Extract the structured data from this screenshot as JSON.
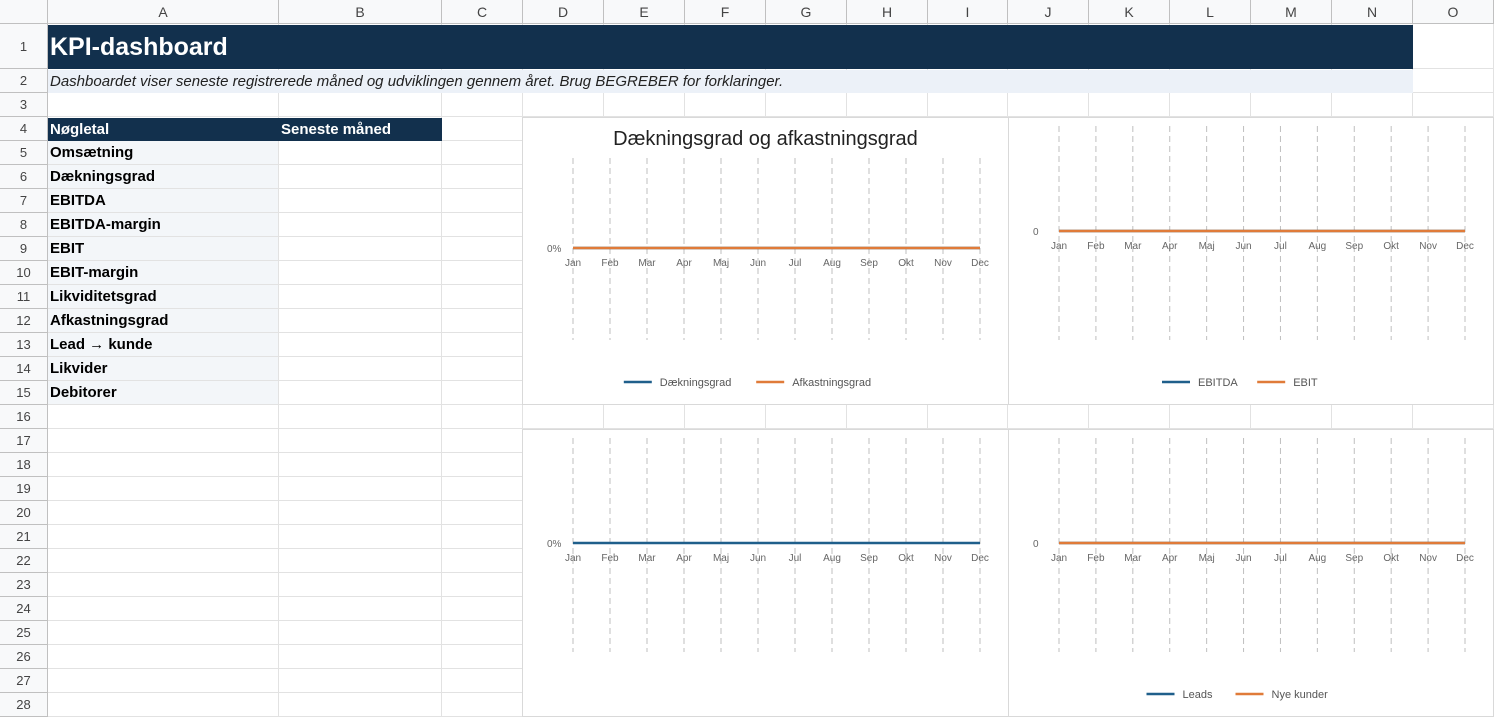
{
  "columns": [
    "A",
    "B",
    "C",
    "D",
    "E",
    "F",
    "G",
    "H",
    "I",
    "J",
    "K",
    "L",
    "M",
    "N",
    "O"
  ],
  "rows": [
    "1",
    "2",
    "3",
    "4",
    "5",
    "6",
    "7",
    "8",
    "9",
    "10",
    "11",
    "12",
    "13",
    "14",
    "15",
    "16",
    "17",
    "18",
    "19",
    "20",
    "21",
    "22",
    "23",
    "24",
    "25",
    "26",
    "27",
    "28"
  ],
  "sheet": {
    "title": "KPI-dashboard",
    "subtitle": "Dashboardet viser seneste registrerede måned og udviklingen gennem året. Brug BEGREBER for forklaringer.",
    "table_header": {
      "col1": "Nøgletal",
      "col2": "Seneste måned"
    },
    "kpis": [
      "Omsætning",
      "Dækningsgrad",
      "EBITDA",
      "EBITDA-margin",
      "EBIT",
      "EBIT-margin",
      "Likviditetsgrad",
      "Afkastningsgrad",
      "Lead → kunde",
      "Likvider",
      "Debitorer"
    ]
  },
  "colors": {
    "navy": "#12304d",
    "blue_series": "#1f5f8b",
    "orange_series": "#e07b39"
  },
  "chart_data": [
    {
      "type": "line",
      "title": "Dækningsgrad og afkastningsgrad",
      "categories": [
        "Jan",
        "Feb",
        "Mar",
        "Apr",
        "Maj",
        "Jun",
        "Jul",
        "Aug",
        "Sep",
        "Okt",
        "Nov",
        "Dec"
      ],
      "y_tick_labels": [
        "0%"
      ],
      "series": [
        {
          "name": "Dækningsgrad",
          "color": "#1f5f8b",
          "values": [
            0,
            0,
            0,
            0,
            0,
            0,
            0,
            0,
            0,
            0,
            0,
            0
          ]
        },
        {
          "name": "Afkastningsgrad",
          "color": "#e07b39",
          "values": [
            0,
            0,
            0,
            0,
            0,
            0,
            0,
            0,
            0,
            0,
            0,
            0
          ]
        }
      ],
      "top_series": "Afkastningsgrad",
      "legend": "bottom",
      "grid": "vertical-dashed"
    },
    {
      "type": "line",
      "title": "",
      "categories": [
        "Jan",
        "Feb",
        "Mar",
        "Apr",
        "Maj",
        "Jun",
        "Jul",
        "Aug",
        "Sep",
        "Okt",
        "Nov",
        "Dec"
      ],
      "y_tick_labels": [
        "0"
      ],
      "series": [
        {
          "name": "EBITDA",
          "color": "#1f5f8b",
          "values": [
            0,
            0,
            0,
            0,
            0,
            0,
            0,
            0,
            0,
            0,
            0,
            0
          ]
        },
        {
          "name": "EBIT",
          "color": "#e07b39",
          "values": [
            0,
            0,
            0,
            0,
            0,
            0,
            0,
            0,
            0,
            0,
            0,
            0
          ]
        }
      ],
      "top_series": "EBIT",
      "legend": "bottom",
      "grid": "vertical-dashed"
    },
    {
      "type": "line",
      "title": "",
      "categories": [
        "Jan",
        "Feb",
        "Mar",
        "Apr",
        "Maj",
        "Jun",
        "Jul",
        "Aug",
        "Sep",
        "Okt",
        "Nov",
        "Dec"
      ],
      "y_tick_labels": [
        "0%"
      ],
      "series": [
        {
          "name": "",
          "color": "#1f5f8b",
          "values": [
            0,
            0,
            0,
            0,
            0,
            0,
            0,
            0,
            0,
            0,
            0,
            0
          ]
        }
      ],
      "top_series": "",
      "legend": "none",
      "grid": "vertical-dashed"
    },
    {
      "type": "line",
      "title": "",
      "categories": [
        "Jan",
        "Feb",
        "Mar",
        "Apr",
        "Maj",
        "Jun",
        "Jul",
        "Aug",
        "Sep",
        "Okt",
        "Nov",
        "Dec"
      ],
      "y_tick_labels": [
        "0"
      ],
      "series": [
        {
          "name": "Leads",
          "color": "#1f5f8b",
          "values": [
            0,
            0,
            0,
            0,
            0,
            0,
            0,
            0,
            0,
            0,
            0,
            0
          ]
        },
        {
          "name": "Nye kunder",
          "color": "#e07b39",
          "values": [
            0,
            0,
            0,
            0,
            0,
            0,
            0,
            0,
            0,
            0,
            0,
            0
          ]
        }
      ],
      "top_series": "Nye kunder",
      "legend": "bottom",
      "grid": "vertical-dashed"
    }
  ]
}
